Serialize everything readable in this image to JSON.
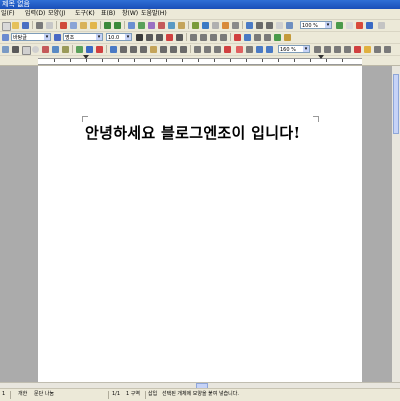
{
  "window": {
    "title": "제목 없음"
  },
  "menu": {
    "items": [
      "일(F)",
      "편집(E)",
      "보기(V)",
      "입력(D)",
      "모양(J)",
      "도구(K)",
      "표(B)",
      "창(W)",
      "도움말(H)"
    ]
  },
  "toolbar1": {
    "zoom_value": "100 %"
  },
  "toolbar2": {
    "style_value": "바탕글",
    "font_value": "명조",
    "size_value": "10.0"
  },
  "toolbar3": {
    "zoom_value": "160 %"
  },
  "colors": {
    "title_bar": "#1f58c6",
    "chrome": "#ece9d8",
    "workspace": "#ababab",
    "page": "#ffffff"
  },
  "document": {
    "text": "안녕하세요 블로그엔조이 입니다!"
  },
  "statusbar": {
    "section": "1",
    "page": "1/1 구역",
    "lang": "개한",
    "mode_word": "문단 나눔",
    "col": "1/1",
    "insert": "1 구역",
    "insert_mode": "삽입",
    "message": "선택된 개체에 모양을 붙여 넣습니다."
  }
}
